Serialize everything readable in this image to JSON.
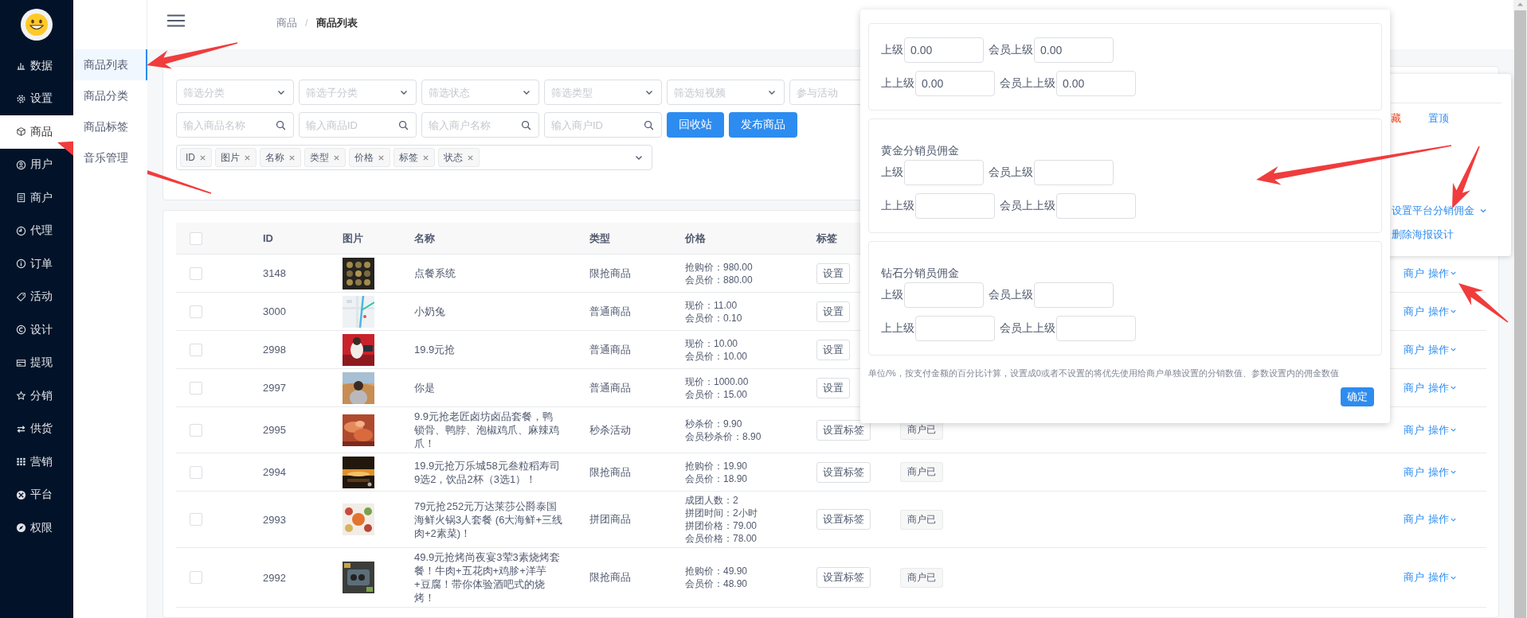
{
  "sidebar": {
    "items": [
      {
        "label": "数据",
        "selected": false
      },
      {
        "label": "设置",
        "selected": false
      },
      {
        "label": "商品",
        "selected": true
      },
      {
        "label": "用户",
        "selected": false
      },
      {
        "label": "商户",
        "selected": false
      },
      {
        "label": "代理",
        "selected": false
      },
      {
        "label": "订单",
        "selected": false
      },
      {
        "label": "活动",
        "selected": false
      },
      {
        "label": "设计",
        "selected": false
      },
      {
        "label": "提现",
        "selected": false
      },
      {
        "label": "分销",
        "selected": false
      },
      {
        "label": "供货",
        "selected": false
      },
      {
        "label": "营销",
        "selected": false
      },
      {
        "label": "平台",
        "selected": false
      },
      {
        "label": "权限",
        "selected": false
      }
    ]
  },
  "subnav": {
    "items": [
      {
        "label": "商品列表",
        "selected": true
      },
      {
        "label": "商品分类",
        "selected": false
      },
      {
        "label": "商品标签",
        "selected": false
      },
      {
        "label": "音乐管理",
        "selected": false
      }
    ]
  },
  "header": {
    "breadcrumb": [
      "商品",
      "商品列表"
    ],
    "separator": "/"
  },
  "filters": {
    "selects": [
      {
        "placeholder": "筛选分类"
      },
      {
        "placeholder": "筛选子分类"
      },
      {
        "placeholder": "筛选状态"
      },
      {
        "placeholder": "筛选类型"
      },
      {
        "placeholder": "筛选短视频"
      },
      {
        "placeholder": "参与活动"
      }
    ],
    "searches": [
      {
        "placeholder": "输入商品名称"
      },
      {
        "placeholder": "输入商品ID"
      },
      {
        "placeholder": "输入商户名称"
      },
      {
        "placeholder": "输入商户ID"
      }
    ],
    "buttons": [
      "回收站",
      "发布商品"
    ],
    "column_tags": [
      "ID",
      "图片",
      "名称",
      "类型",
      "价格",
      "标签",
      "状态"
    ]
  },
  "table": {
    "header_checkbox": {
      "checked": false
    },
    "columns": [
      "ID",
      "图片",
      "名称",
      "类型",
      "价格",
      "标签"
    ],
    "rows": [
      {
        "checked": false,
        "id": "3148",
        "name": "点餐系统",
        "type": "限抢商品",
        "prices": [
          "抢购价：980.00",
          "会员价：880.00"
        ],
        "tag_button": "设置",
        "actions": [
          "商户",
          "操作"
        ]
      },
      {
        "checked": false,
        "id": "3000",
        "name": "小奶兔",
        "type": "普通商品",
        "prices": [
          "现价：11.00",
          "会员价：0.10"
        ],
        "tag_button": "设置",
        "actions": [
          "商户",
          "操作"
        ]
      },
      {
        "checked": false,
        "id": "2998",
        "name": "19.9元抢",
        "type": "普通商品",
        "prices": [
          "现价：10.00",
          "会员价：10.00"
        ],
        "tag_button": "设置",
        "actions": [
          "商户",
          "操作"
        ]
      },
      {
        "checked": false,
        "id": "2997",
        "name": "你是",
        "type": "普通商品",
        "prices": [
          "现价：1000.00",
          "会员价：15.00"
        ],
        "tag_button": "设置",
        "actions": [
          "商户",
          "操作"
        ]
      },
      {
        "checked": false,
        "id": "2995",
        "name": "9.9元抢老匠卤坊卤品套餐，鸭锁骨、鸭脖、泡椒鸡爪、麻辣鸡爪！",
        "type": "秒杀活动",
        "prices": [
          "秒杀价：9.90",
          "会员秒杀价：8.90"
        ],
        "tag_button": "设置标签",
        "merchant_tag": "商户已",
        "actions": [
          "商户",
          "操作"
        ]
      },
      {
        "checked": false,
        "id": "2994",
        "name": "19.9元抢万乐城58元叁粒稻寿司9选2，饮品2杯（3选1）！",
        "type": "限抢商品",
        "prices": [
          "抢购价：19.90",
          "会员价：18.90"
        ],
        "tag_button": "设置标签",
        "merchant_tag": "商户已",
        "actions": [
          "商户",
          "操作"
        ]
      },
      {
        "checked": false,
        "id": "2993",
        "name": "79元抢252元万达莱莎公爵泰国海鲜火锅3人套餐 (6大海鲜+三线肉+2素菜)！",
        "type": "拼团商品",
        "prices": [
          "成团人数：2",
          "拼团时间：2小时",
          "拼团价格：79.00",
          "会员价格：78.00"
        ],
        "tag_button": "设置标签",
        "merchant_tag": "商户已",
        "actions": [
          "商户",
          "操作"
        ]
      },
      {
        "checked": false,
        "id": "2992",
        "name": "49.9元抢烤尚夜宴3荤3素烧烤套餐！牛肉+五花肉+鸡胗+洋芋+豆腐！带你体验酒吧式的烧烤！",
        "type": "限抢商品",
        "prices": [
          "抢购价：49.90",
          "会员价：48.90"
        ],
        "tag_button": "设置标签",
        "merchant_tag": "商户已",
        "actions": [
          "商户",
          "操作"
        ]
      }
    ]
  },
  "action_menu": {
    "top_links": [
      {
        "label": "藏",
        "kind": "danger"
      },
      {
        "label": "置顶",
        "kind": "link"
      }
    ],
    "items": [
      {
        "label": "设置平台分销佣金",
        "kind": "submenu"
      },
      {
        "label": "删除海报设计",
        "kind": "link"
      }
    ]
  },
  "commission_dialog": {
    "sections": [
      {
        "fields": [
          {
            "label": "上级",
            "value": "0.00"
          },
          {
            "label": "会员上级",
            "value": "0.00"
          },
          {
            "label": "上上级",
            "value": "0.00"
          },
          {
            "label": "会员上上级",
            "value": "0.00"
          }
        ]
      },
      {
        "title": "黄金分销员佣金",
        "fields": [
          {
            "label": "上级"
          },
          {
            "label": "会员上级"
          },
          {
            "label": "上上级"
          },
          {
            "label": "会员上上级"
          }
        ]
      },
      {
        "title": "钻石分销员佣金",
        "fields": [
          {
            "label": "上级"
          },
          {
            "label": "会员上级"
          },
          {
            "label": "上上级"
          },
          {
            "label": "会员上上级"
          }
        ]
      }
    ],
    "note": "单位/%，按支付金额的百分比计算，设置成0或者不设置的将优先使用给商户单独设置的分销数值、参数设置内的佣金数值",
    "confirm": "确定"
  }
}
